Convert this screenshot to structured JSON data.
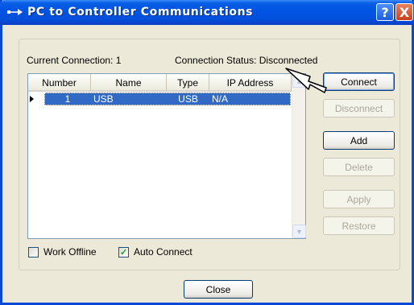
{
  "window": {
    "title": "PC to Controller Communications",
    "help_glyph": "?",
    "close_glyph": "X"
  },
  "status": {
    "current_connection": "Current Connection: 1",
    "connection_status": "Connection Status: Disconnected"
  },
  "list": {
    "columns": [
      "Number",
      "Name",
      "Type",
      "IP Address"
    ],
    "rows": [
      {
        "number": "1",
        "name": "USB",
        "type": "USB",
        "ip": "N/A"
      }
    ]
  },
  "buttons": {
    "connect": "Connect",
    "disconnect": "Disconnect",
    "add": "Add",
    "delete": "Delete",
    "apply": "Apply",
    "restore": "Restore",
    "close": "Close"
  },
  "options": {
    "work_offline": {
      "label": "Work Offline",
      "checked": false
    },
    "auto_connect": {
      "label": "Auto Connect",
      "checked": true
    }
  },
  "colors": {
    "titlebar": "#0054e3",
    "selection": "#316ac5",
    "dialog_bg": "#ece9d8",
    "check_mark": "#21a121"
  },
  "icons": {
    "title": "serial-cable-icon",
    "row_indicator": "row-pointer-icon",
    "check": "check-mark-icon",
    "cursor": "mouse-pointer-icon"
  }
}
